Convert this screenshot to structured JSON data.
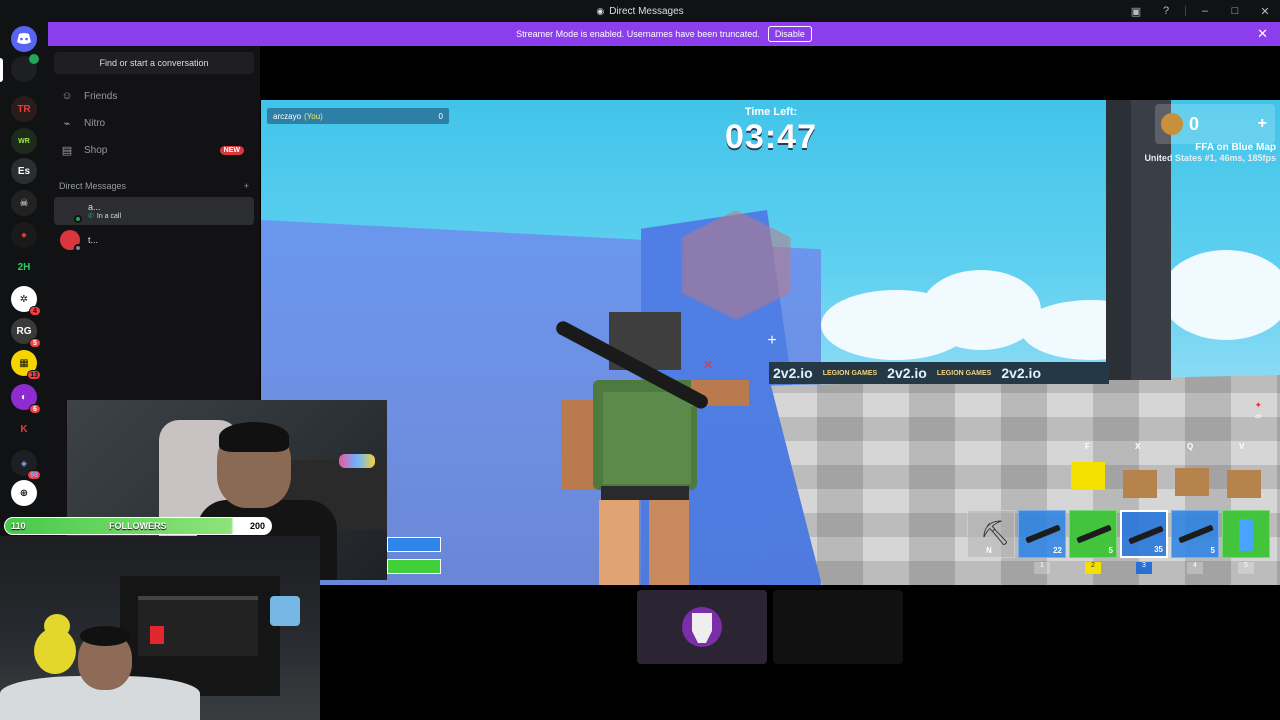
{
  "window": {
    "title": "Direct Messages"
  },
  "banner": {
    "text": "Streamer Mode is enabled. Usernames have been truncated.",
    "disable_label": "Disable"
  },
  "servers": [
    {
      "label": "",
      "badge": ""
    },
    {
      "label": "TR",
      "badge": ""
    },
    {
      "label": "",
      "badge": ""
    },
    {
      "label": "Es",
      "badge": ""
    },
    {
      "label": "",
      "badge": ""
    },
    {
      "label": "",
      "badge": ""
    },
    {
      "label": "2H",
      "badge": ""
    },
    {
      "label": "",
      "badge": "4"
    },
    {
      "label": "RG",
      "badge": "5"
    },
    {
      "label": "",
      "badge": "13"
    },
    {
      "label": "",
      "badge": "6"
    },
    {
      "label": "",
      "badge": ""
    },
    {
      "label": "",
      "badge": "98"
    },
    {
      "label": "",
      "badge": ""
    }
  ],
  "sidebar": {
    "search_placeholder": "Find or start a conversation",
    "nav": [
      {
        "label": "Friends",
        "icon": "friends-icon"
      },
      {
        "label": "Nitro",
        "icon": "nitro-icon"
      },
      {
        "label": "Shop",
        "icon": "shop-icon",
        "badge": "NEW"
      }
    ],
    "dm_header": "Direct Messages",
    "dm_add": "+",
    "dms": [
      {
        "name": "a...",
        "status": "In a call"
      },
      {
        "name": "t...",
        "status": ""
      }
    ]
  },
  "game": {
    "player_name": "arczayo",
    "player_tag": "(You)",
    "player_score": "0",
    "time_label": "Time Left:",
    "time_value": "03:47",
    "coins": "0",
    "coins_plus": "+",
    "map_name": "FFA on Blue Map",
    "server_info": "United States #1, 46ms, 185fps",
    "ammo_side": "∞",
    "banner_text": "2v2.io",
    "banner_logo": "LEGION GAMES",
    "build_keys": [
      "F",
      "X",
      "Q",
      "V"
    ],
    "hotbar": [
      {
        "amount": "N",
        "num": ""
      },
      {
        "amount": "22",
        "num": "1"
      },
      {
        "amount": "5",
        "num": "2"
      },
      {
        "amount": "35",
        "num": "3"
      },
      {
        "amount": "5",
        "num": "4"
      },
      {
        "amount": "",
        "num": "5"
      }
    ]
  },
  "overlay": {
    "followers_current": "110",
    "followers_label": "FOLLOWERS",
    "followers_goal": "200",
    "followers_progress": 0.86
  },
  "colors": {
    "accent": "#8c3dec",
    "online": "#23a55a",
    "sidebar": "#121214"
  }
}
